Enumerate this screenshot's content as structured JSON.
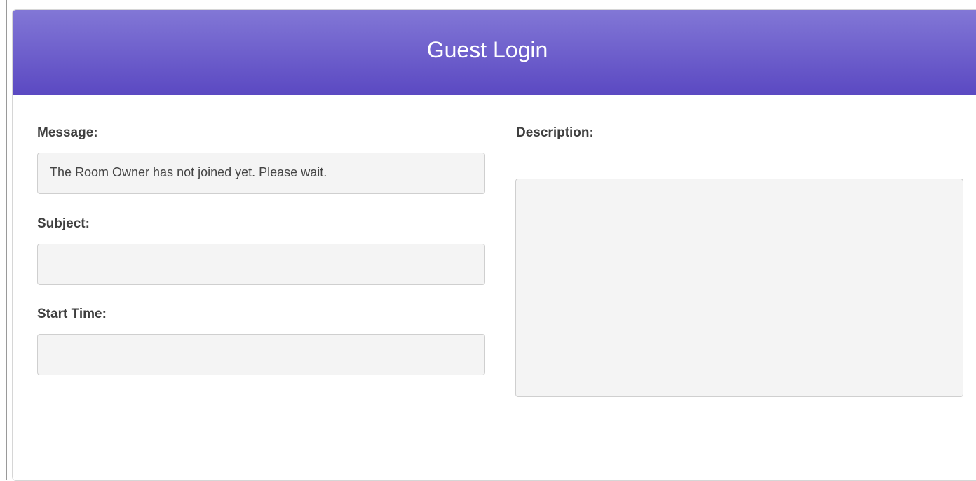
{
  "header": {
    "title": "Guest Login"
  },
  "form": {
    "message_label": "Message:",
    "message_value": "The Room Owner has not joined yet. Please wait.",
    "subject_label": "Subject:",
    "subject_value": "",
    "start_time_label": "Start Time:",
    "start_time_value": "",
    "description_label": "Description:",
    "description_value": ""
  },
  "colors": {
    "header_top": "#8277d6",
    "header_bottom": "#5b49c2",
    "field_background": "#f4f4f4"
  }
}
